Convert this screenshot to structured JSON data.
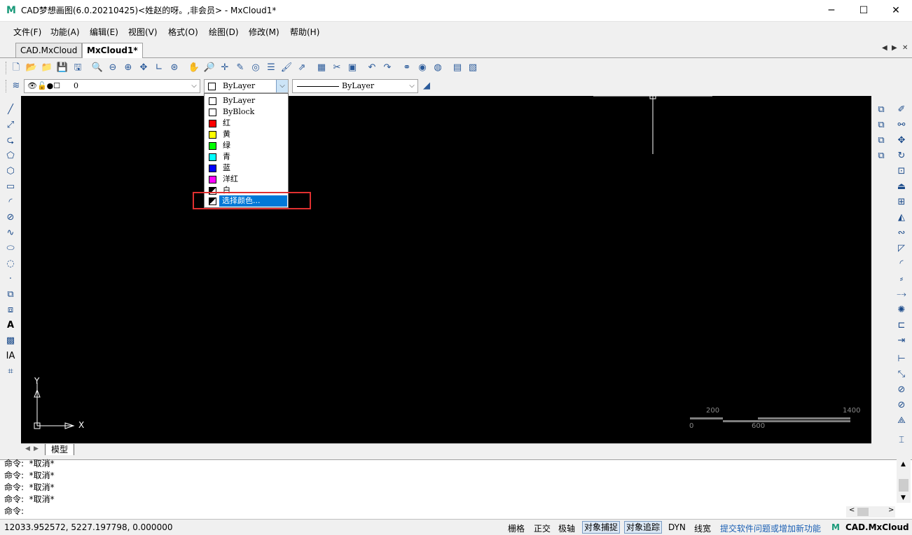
{
  "window": {
    "title": "CAD梦想画图(6.0.20210425)<姓赵的呀。,非会员> - MxCloud1*",
    "logo": "M",
    "minimize_icon": "─",
    "maximize_icon": "☐",
    "close_icon": "✕"
  },
  "menu": [
    "文件(F)",
    "功能(A)",
    "编辑(E)",
    "视图(V)",
    "格式(O)",
    "绘图(D)",
    "修改(M)",
    "帮助(H)"
  ],
  "tabs": [
    {
      "label": "CAD.MxCloud"
    },
    {
      "label": "MxCloud1*"
    }
  ],
  "tab_nav": {
    "prev": "◀",
    "next": "▶",
    "close": "✕"
  },
  "properties": {
    "layer_value": "0",
    "color_value": "ByLayer",
    "linetype_value": "ByLayer"
  },
  "color_dropdown": {
    "items": [
      {
        "label": "ByLayer",
        "color": "#ffffff"
      },
      {
        "label": "ByBlock",
        "color": "#ffffff"
      },
      {
        "label": "红",
        "color": "#ff0000"
      },
      {
        "label": "黄",
        "color": "#ffff00"
      },
      {
        "label": "绿",
        "color": "#00ff00"
      },
      {
        "label": "青",
        "color": "#00ffff"
      },
      {
        "label": "蓝",
        "color": "#0000ff"
      },
      {
        "label": "洋红",
        "color": "#ff00ff"
      },
      {
        "label": "白",
        "color": "#000000"
      },
      {
        "label": "选择颜色...",
        "color": "#000000"
      }
    ],
    "highlight_color": "#e03030"
  },
  "canvas": {
    "axis_y": "Y",
    "axis_x": "X",
    "scale_top_left": "200",
    "scale_top_right": "1400",
    "scale_bottom_left": "0",
    "scale_bottom_mid": "600"
  },
  "model_tab": "模型",
  "command_history": [
    "命令:  *取消*",
    "命令:  *取消*",
    "命令:  *取消*",
    "命令:  *取消*"
  ],
  "command_prompt": "命令:",
  "status": {
    "coords": "12033.952572,  5227.197798,  0.000000",
    "toggles": [
      {
        "label": "栅格",
        "on": false
      },
      {
        "label": "正交",
        "on": false
      },
      {
        "label": "极轴",
        "on": false
      },
      {
        "label": "对象捕捉",
        "on": true
      },
      {
        "label": "对象追踪",
        "on": true
      },
      {
        "label": "DYN",
        "on": false
      },
      {
        "label": "线宽",
        "on": false
      }
    ],
    "feedback_link": "提交软件问题或增加新功能",
    "brand": "CAD.MxCloud"
  }
}
